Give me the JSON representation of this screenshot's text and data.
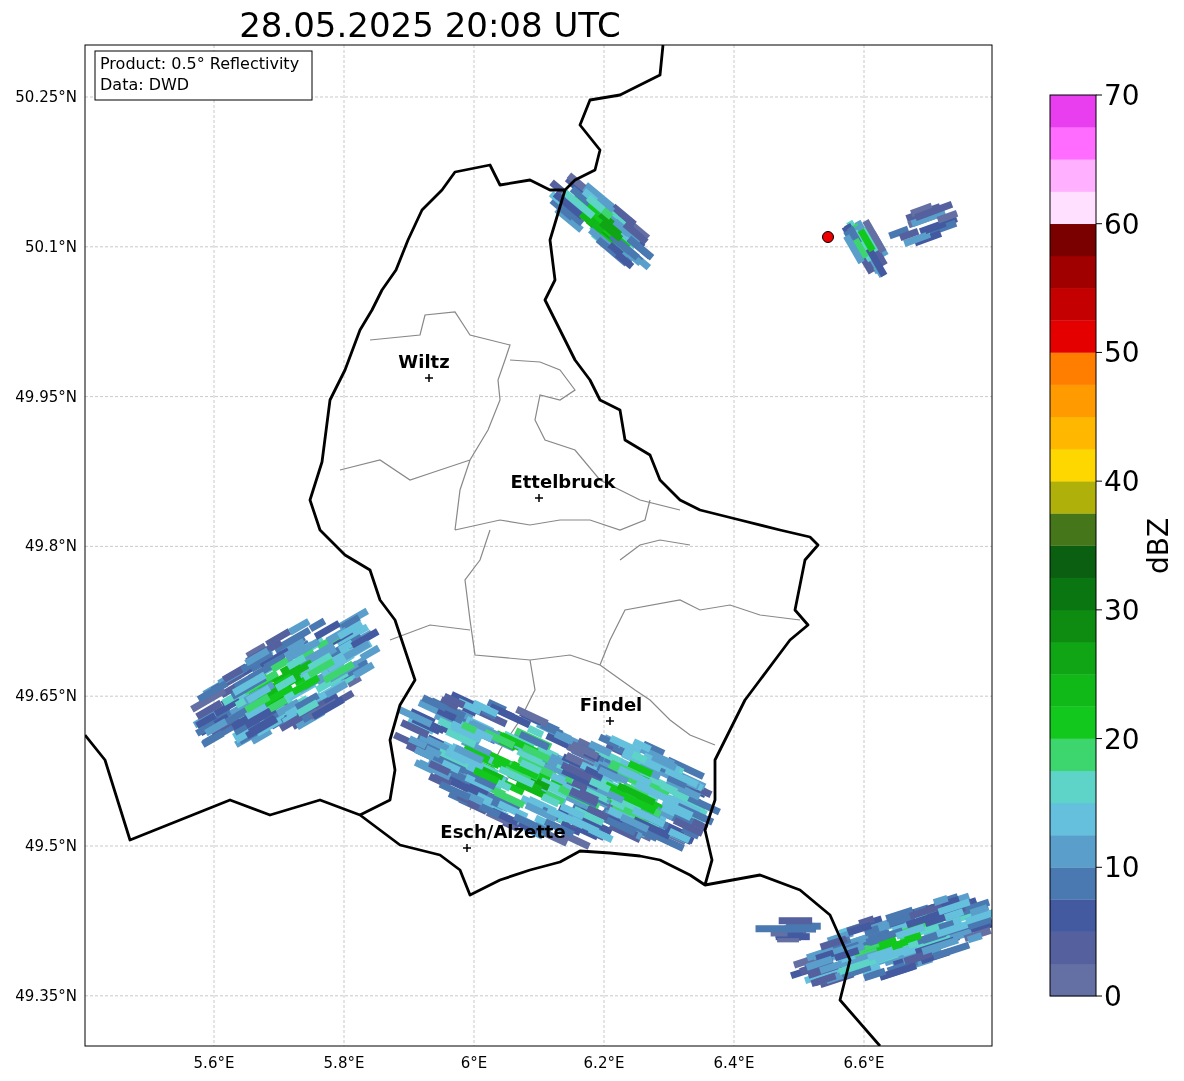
{
  "title": "28.05.2025 20:08 UTC",
  "info_box": [
    "Product: 0.5° Reflectivity",
    "Data: DWD"
  ],
  "lat_ticks": [
    "50.25°N",
    "50.1°N",
    "49.95°N",
    "49.8°N",
    "49.65°N",
    "49.5°N",
    "49.35°N"
  ],
  "lon_ticks": [
    "5.6°E",
    "5.8°E",
    "6°E",
    "6.2°E",
    "6.4°E",
    "6.6°E"
  ],
  "places": [
    {
      "name": "Wiltz"
    },
    {
      "name": "Ettelbruck"
    },
    {
      "name": "Findel"
    },
    {
      "name": "Esch/Alzette"
    }
  ],
  "colorbar": {
    "label": "dBZ",
    "ticks": [
      "70",
      "60",
      "50",
      "40",
      "30",
      "20",
      "10",
      "0"
    ],
    "bands": [
      {
        "color": "#6470a4"
      },
      {
        "color": "#54619e"
      },
      {
        "color": "#435aa0"
      },
      {
        "color": "#4a78b0"
      },
      {
        "color": "#5a9fcb"
      },
      {
        "color": "#64c0dc"
      },
      {
        "color": "#5ed4c8"
      },
      {
        "color": "#3dd66e"
      },
      {
        "color": "#12c81c"
      },
      {
        "color": "#10b818"
      },
      {
        "color": "#0fa514"
      },
      {
        "color": "#0e8c12"
      },
      {
        "color": "#0a7612"
      },
      {
        "color": "#0a5f10"
      },
      {
        "color": "#46761a"
      },
      {
        "color": "#afb10a"
      },
      {
        "color": "#fed600"
      },
      {
        "color": "#ffb700"
      },
      {
        "color": "#ff9b00"
      },
      {
        "color": "#ff7e00"
      },
      {
        "color": "#e50000"
      },
      {
        "color": "#c40000"
      },
      {
        "color": "#a00000"
      },
      {
        "color": "#7a0000"
      },
      {
        "color": "#ffe0ff"
      },
      {
        "color": "#ffb0ff"
      },
      {
        "color": "#ff6cff"
      },
      {
        "color": "#e83ef0"
      }
    ]
  }
}
